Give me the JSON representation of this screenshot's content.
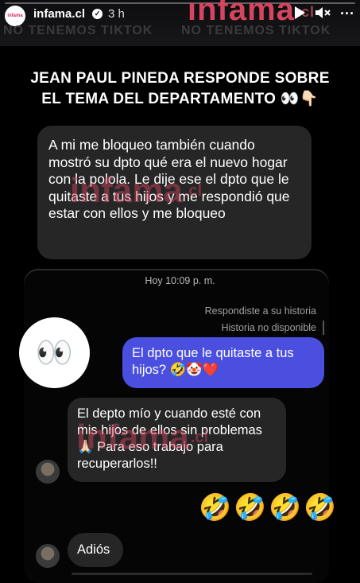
{
  "story_header": {
    "username": "infama.cl",
    "time_ago": "3 h",
    "avatar_text": "infama"
  },
  "banner": {
    "brand": "infama",
    "brand_suffix": ".cl",
    "tagline_left": "NO TENEMOS TIKTOK",
    "tagline_right": "NO TENEMOS TIKTOK"
  },
  "headline": {
    "line1": "JEAN PAUL PINEDA RESPONDE SOBRE",
    "line2": "EL TEMA DEL DEPARTAMENTO 👀👇🏻"
  },
  "top_message": {
    "text": "A mi me bloqueo también cuando mostró su dpto qué era el nuevo hogar  con la polola. Le dije ese el dpto que le quitaste a tus hijos y me respondió que estar con ellos y me bloqueo"
  },
  "chat": {
    "timestamp": "Hoy 10:09 p. m.",
    "replied_label": "Respondiste a su historia",
    "story_unavailable": "Historia no disponible",
    "sticker": "👀",
    "sent_message": "El dpto que le quitaste a tus hijos? 🤣🤡❤️",
    "received_message": "El depto mío y cuando esté con mis hijos de ellos sin problemas 🙏🏻 Para eso trabajo para recuperarlos!!",
    "emoji_reply": "🤣🤣🤣🤣",
    "last_message": "Adiós"
  },
  "watermarks": {
    "brand": "infama",
    "suffix": ".cl"
  },
  "colors": {
    "sent_bubble": "#4a4fe0",
    "received_bubble": "#262626",
    "brand": "#d64560"
  },
  "icons": {
    "verified": "verified-badge-icon",
    "play": "play-icon",
    "mute": "mute-icon",
    "more": "more-options-icon"
  }
}
